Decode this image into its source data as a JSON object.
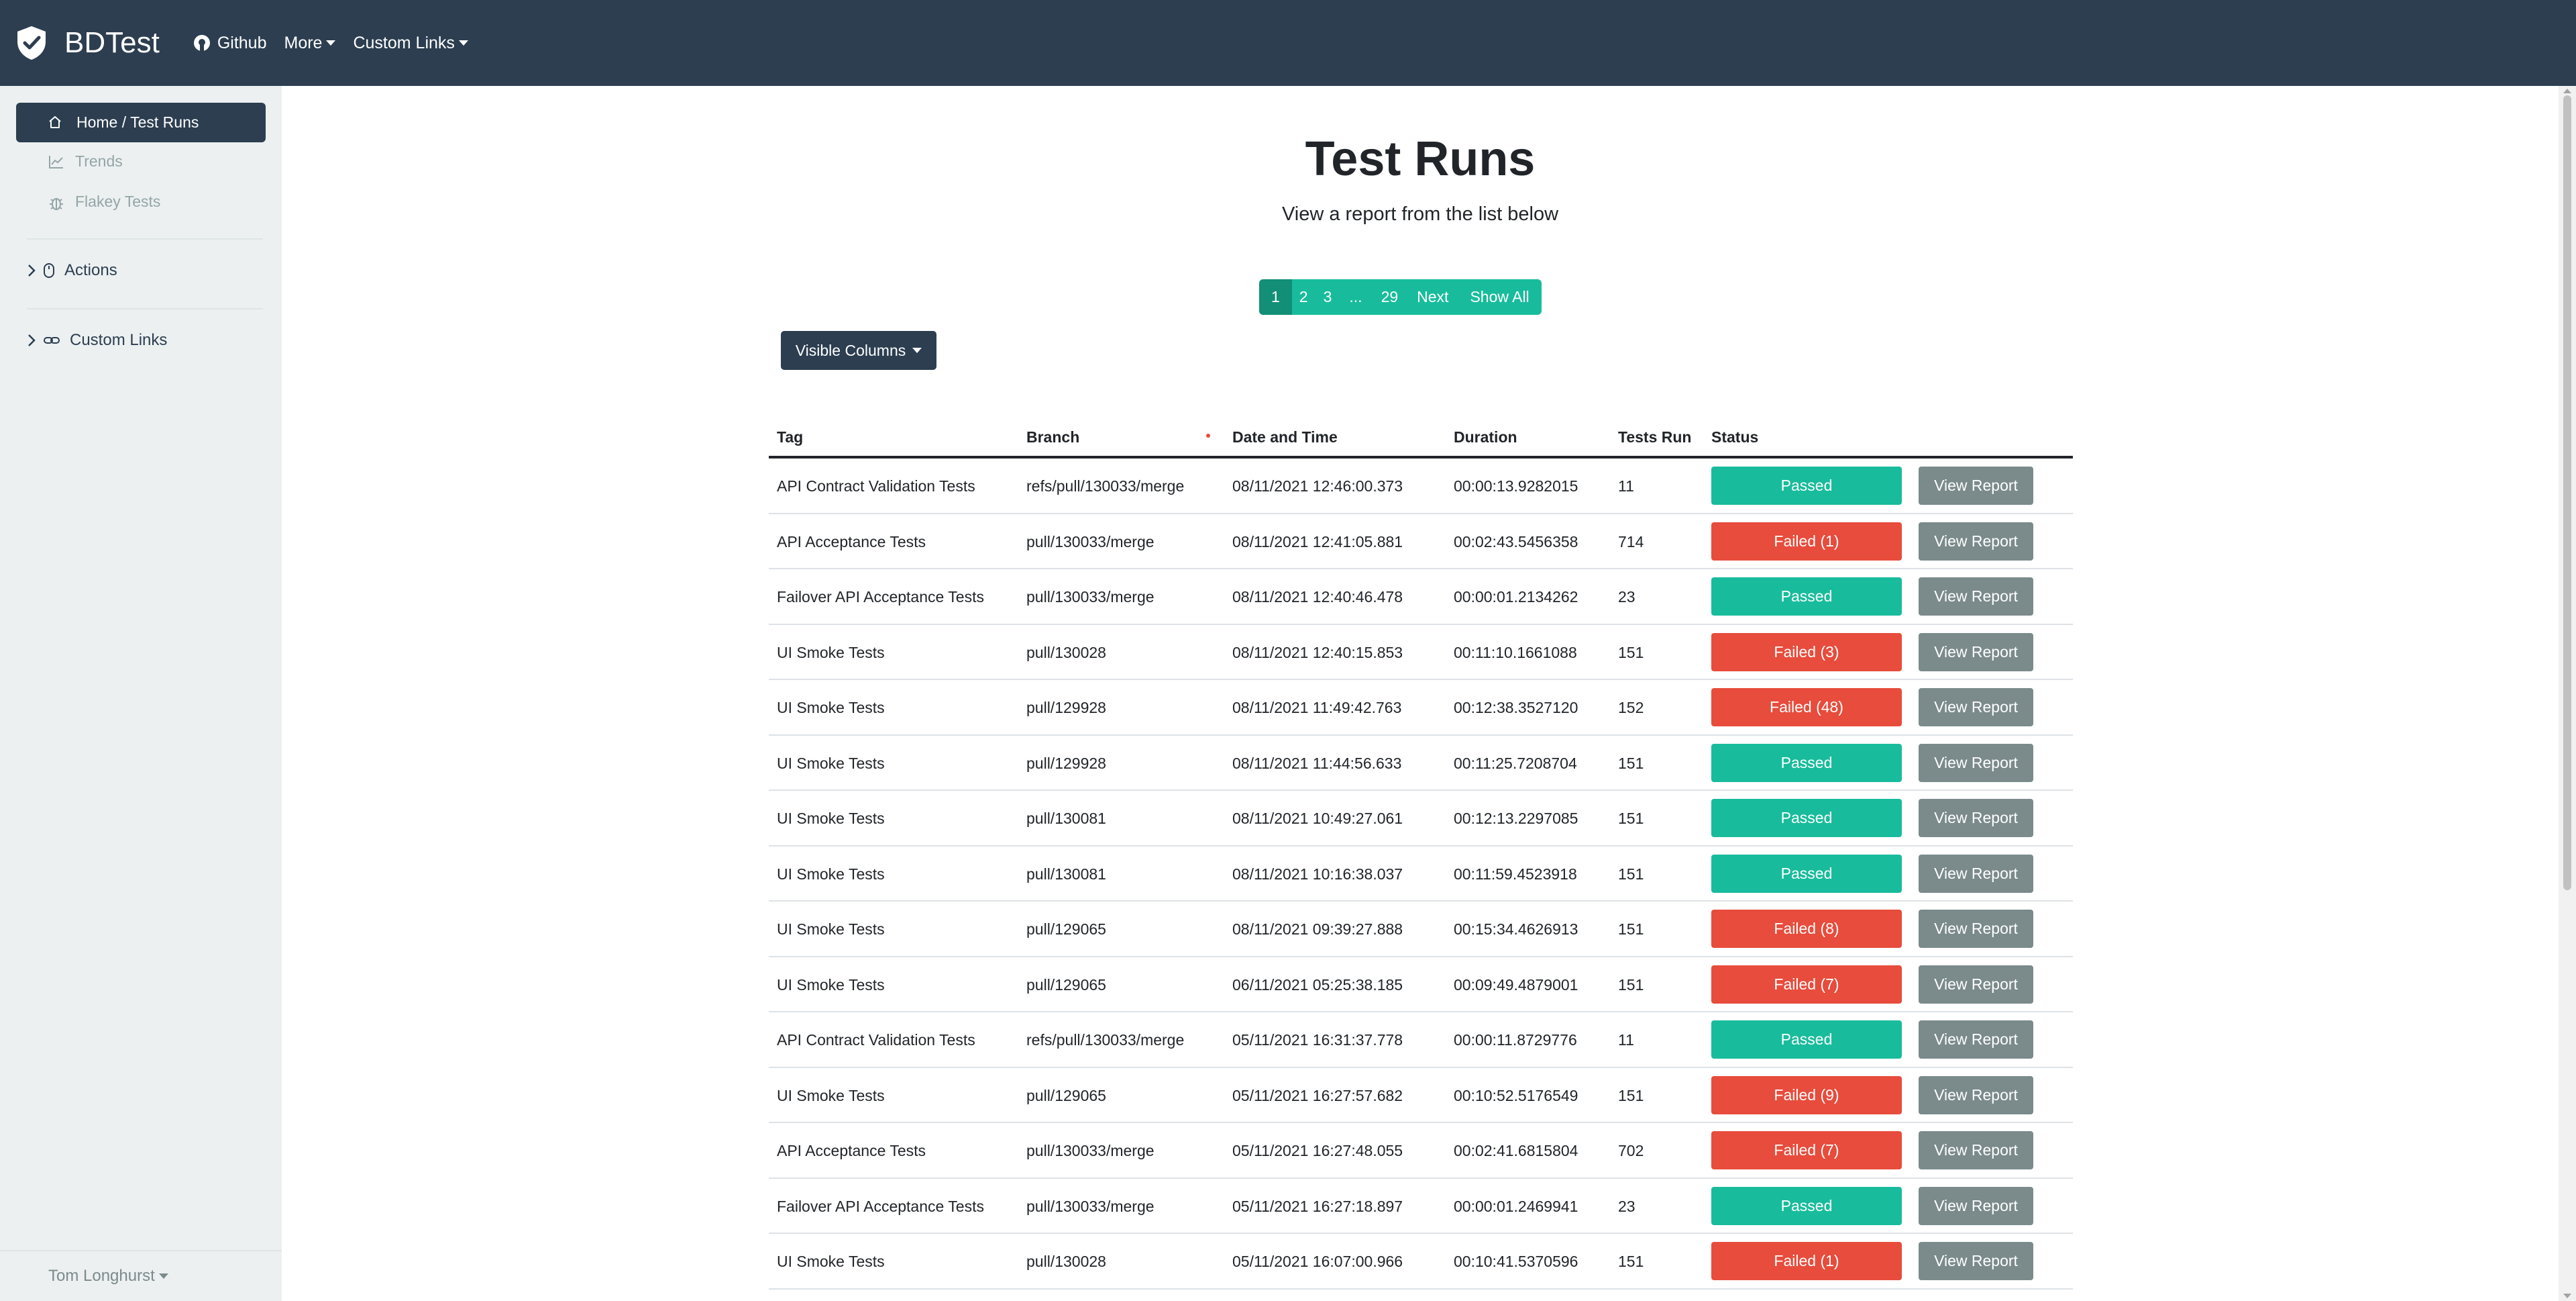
{
  "navbar": {
    "brand": "BDTest",
    "links": [
      {
        "label": "Github",
        "icon": "github-icon",
        "dropdown": false
      },
      {
        "label": "More",
        "dropdown": true
      },
      {
        "label": "Custom Links",
        "dropdown": true
      }
    ]
  },
  "sidebar": {
    "active": {
      "label": "Home / Test Runs",
      "icon": "home-icon"
    },
    "items": [
      {
        "label": "Trends",
        "icon": "chart-line-icon"
      },
      {
        "label": "Flakey Tests",
        "icon": "bug-icon"
      }
    ],
    "groups": [
      {
        "label": "Actions",
        "icon": "mouse-icon"
      },
      {
        "label": "Custom Links",
        "icon": "link-icon"
      }
    ],
    "user": "Tom Longhurst"
  },
  "main": {
    "title": "Test Runs",
    "subtitle": "View a report from the list below",
    "pagination": [
      "1",
      "2",
      "3",
      "...",
      "29",
      "Next",
      "Show All"
    ],
    "visible_columns_label": "Visible Columns",
    "columns": [
      "Tag",
      "Branch",
      "Date and Time",
      "Duration",
      "Tests Run",
      "Status"
    ],
    "view_report_label": "View Report",
    "rows": [
      {
        "tag": "API Contract Validation Tests",
        "branch": "refs/pull/130033/merge",
        "date": "08/11/2021 12:46:00.373",
        "duration": "00:00:13.9282015",
        "tests": "11",
        "status": "Passed",
        "passed": true
      },
      {
        "tag": "API Acceptance Tests",
        "branch": "pull/130033/merge",
        "date": "08/11/2021 12:41:05.881",
        "duration": "00:02:43.5456358",
        "tests": "714",
        "status": "Failed (1)",
        "passed": false
      },
      {
        "tag": "Failover API Acceptance Tests",
        "branch": "pull/130033/merge",
        "date": "08/11/2021 12:40:46.478",
        "duration": "00:00:01.2134262",
        "tests": "23",
        "status": "Passed",
        "passed": true
      },
      {
        "tag": "UI Smoke Tests",
        "branch": "pull/130028",
        "date": "08/11/2021 12:40:15.853",
        "duration": "00:11:10.1661088",
        "tests": "151",
        "status": "Failed (3)",
        "passed": false
      },
      {
        "tag": "UI Smoke Tests",
        "branch": "pull/129928",
        "date": "08/11/2021 11:49:42.763",
        "duration": "00:12:38.3527120",
        "tests": "152",
        "status": "Failed (48)",
        "passed": false
      },
      {
        "tag": "UI Smoke Tests",
        "branch": "pull/129928",
        "date": "08/11/2021 11:44:56.633",
        "duration": "00:11:25.7208704",
        "tests": "151",
        "status": "Passed",
        "passed": true
      },
      {
        "tag": "UI Smoke Tests",
        "branch": "pull/130081",
        "date": "08/11/2021 10:49:27.061",
        "duration": "00:12:13.2297085",
        "tests": "151",
        "status": "Passed",
        "passed": true
      },
      {
        "tag": "UI Smoke Tests",
        "branch": "pull/130081",
        "date": "08/11/2021 10:16:38.037",
        "duration": "00:11:59.4523918",
        "tests": "151",
        "status": "Passed",
        "passed": true
      },
      {
        "tag": "UI Smoke Tests",
        "branch": "pull/129065",
        "date": "08/11/2021 09:39:27.888",
        "duration": "00:15:34.4626913",
        "tests": "151",
        "status": "Failed (8)",
        "passed": false
      },
      {
        "tag": "UI Smoke Tests",
        "branch": "pull/129065",
        "date": "06/11/2021 05:25:38.185",
        "duration": "00:09:49.4879001",
        "tests": "151",
        "status": "Failed (7)",
        "passed": false
      },
      {
        "tag": "API Contract Validation Tests",
        "branch": "refs/pull/130033/merge",
        "date": "05/11/2021 16:31:37.778",
        "duration": "00:00:11.8729776",
        "tests": "11",
        "status": "Passed",
        "passed": true
      },
      {
        "tag": "UI Smoke Tests",
        "branch": "pull/129065",
        "date": "05/11/2021 16:27:57.682",
        "duration": "00:10:52.5176549",
        "tests": "151",
        "status": "Failed (9)",
        "passed": false
      },
      {
        "tag": "API Acceptance Tests",
        "branch": "pull/130033/merge",
        "date": "05/11/2021 16:27:48.055",
        "duration": "00:02:41.6815804",
        "tests": "702",
        "status": "Failed (7)",
        "passed": false
      },
      {
        "tag": "Failover API Acceptance Tests",
        "branch": "pull/130033/merge",
        "date": "05/11/2021 16:27:18.897",
        "duration": "00:00:01.2469941",
        "tests": "23",
        "status": "Passed",
        "passed": true
      },
      {
        "tag": "UI Smoke Tests",
        "branch": "pull/130028",
        "date": "05/11/2021 16:07:00.966",
        "duration": "00:10:41.5370596",
        "tests": "151",
        "status": "Failed (1)",
        "passed": false
      }
    ]
  },
  "colors": {
    "navbar": "#2c3e50",
    "sidebar": "#ecf0f1",
    "success": "#18bc9c",
    "danger": "#e74c3c",
    "secondary": "#7b8a8b"
  }
}
